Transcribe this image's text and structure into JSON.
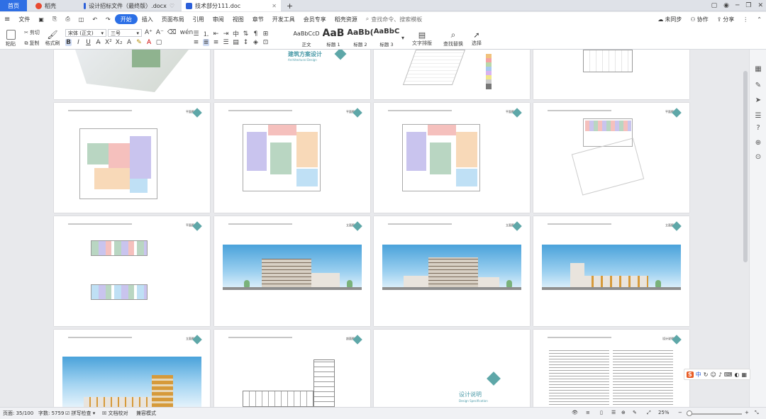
{
  "tabs": [
    {
      "label": "首页",
      "icon_color": "#2f6fe4"
    },
    {
      "label": "稻壳",
      "icon_color": "#e8492f"
    },
    {
      "label": "设计招标文件（最终版）.docx",
      "icon_color": "#2b5fd9"
    },
    {
      "label": "技术部分111.doc",
      "icon_color": "#2b5fd9"
    }
  ],
  "new_tab": "+",
  "menu": {
    "file": "文件",
    "items": [
      "开始",
      "插入",
      "页面布局",
      "引用",
      "审阅",
      "视图",
      "章节",
      "开发工具",
      "会员专享",
      "稻壳资源"
    ],
    "active": "开始",
    "search": "查找命令、搜索模板",
    "sync": "未同步",
    "collab": "协作",
    "share": "分享"
  },
  "ribbon": {
    "paste": "粘贴",
    "cut": "剪切",
    "copy": "复制",
    "format_painter": "格式刷",
    "font_name": "宋体 (正文)",
    "font_size": "三号",
    "styles": [
      {
        "preview": "AaBbCcD",
        "label": "正文"
      },
      {
        "preview": "AaB",
        "label": "标题 1"
      },
      {
        "preview": "AaBb(",
        "label": "标题 2"
      },
      {
        "preview": "AaBbC",
        "label": "标题 3"
      }
    ],
    "text_layout": "文字排版",
    "find_replace": "查找替换",
    "select": "选择"
  },
  "pages": {
    "cover_title": "建筑方案设计",
    "cover_subtitle": "Architectural Design",
    "spec_title": "设计说明",
    "spec_subtitle": "Design Specification",
    "plan_title": "平面图",
    "elev_title": "立面图",
    "sect_title": "剖面图",
    "spec_head": "设计说明"
  },
  "status": {
    "page": "页面: 35/100",
    "words": "字数: 5759",
    "spell": "拼写检查",
    "doc_check": "文档校对",
    "compat": "兼容模式",
    "zoom": "25%"
  },
  "ime": "中"
}
